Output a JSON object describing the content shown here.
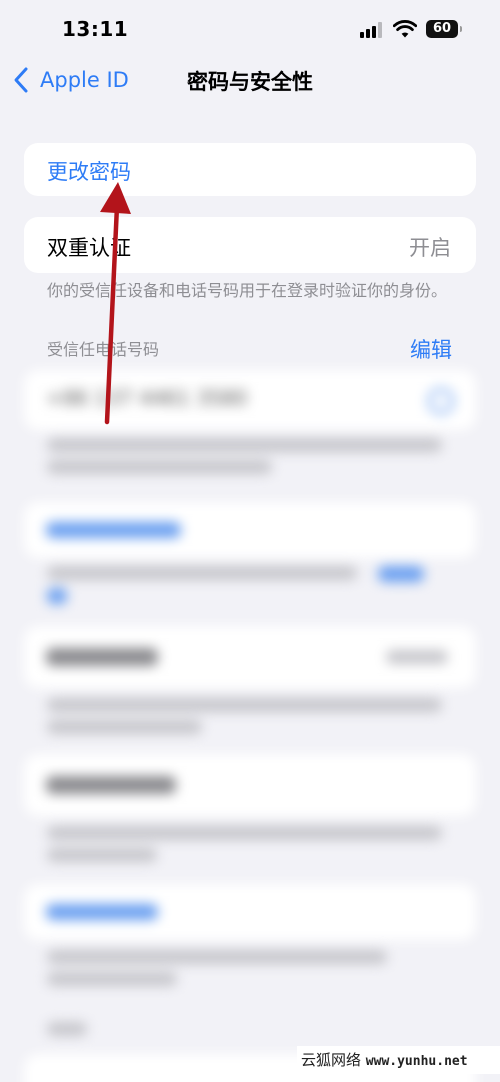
{
  "status_bar": {
    "time": "13:11",
    "battery": "60"
  },
  "nav": {
    "back_label": "Apple ID",
    "title": "密码与安全性"
  },
  "change_password": {
    "label": "更改密码"
  },
  "two_factor": {
    "label": "双重认证",
    "value": "开启",
    "description": "你的受信任设备和电话号码用于在登录时验证你的身份。"
  },
  "trusted_numbers": {
    "header": "受信任电话号码",
    "edit_label": "编辑",
    "number": "+86 137 4461 3580"
  },
  "watermark": {
    "brand": "云狐网络",
    "url": "www.yunhu.net"
  },
  "colors": {
    "accent": "#2e7cf6",
    "annotation_arrow": "#b3141b",
    "background": "#f2f2f7"
  }
}
